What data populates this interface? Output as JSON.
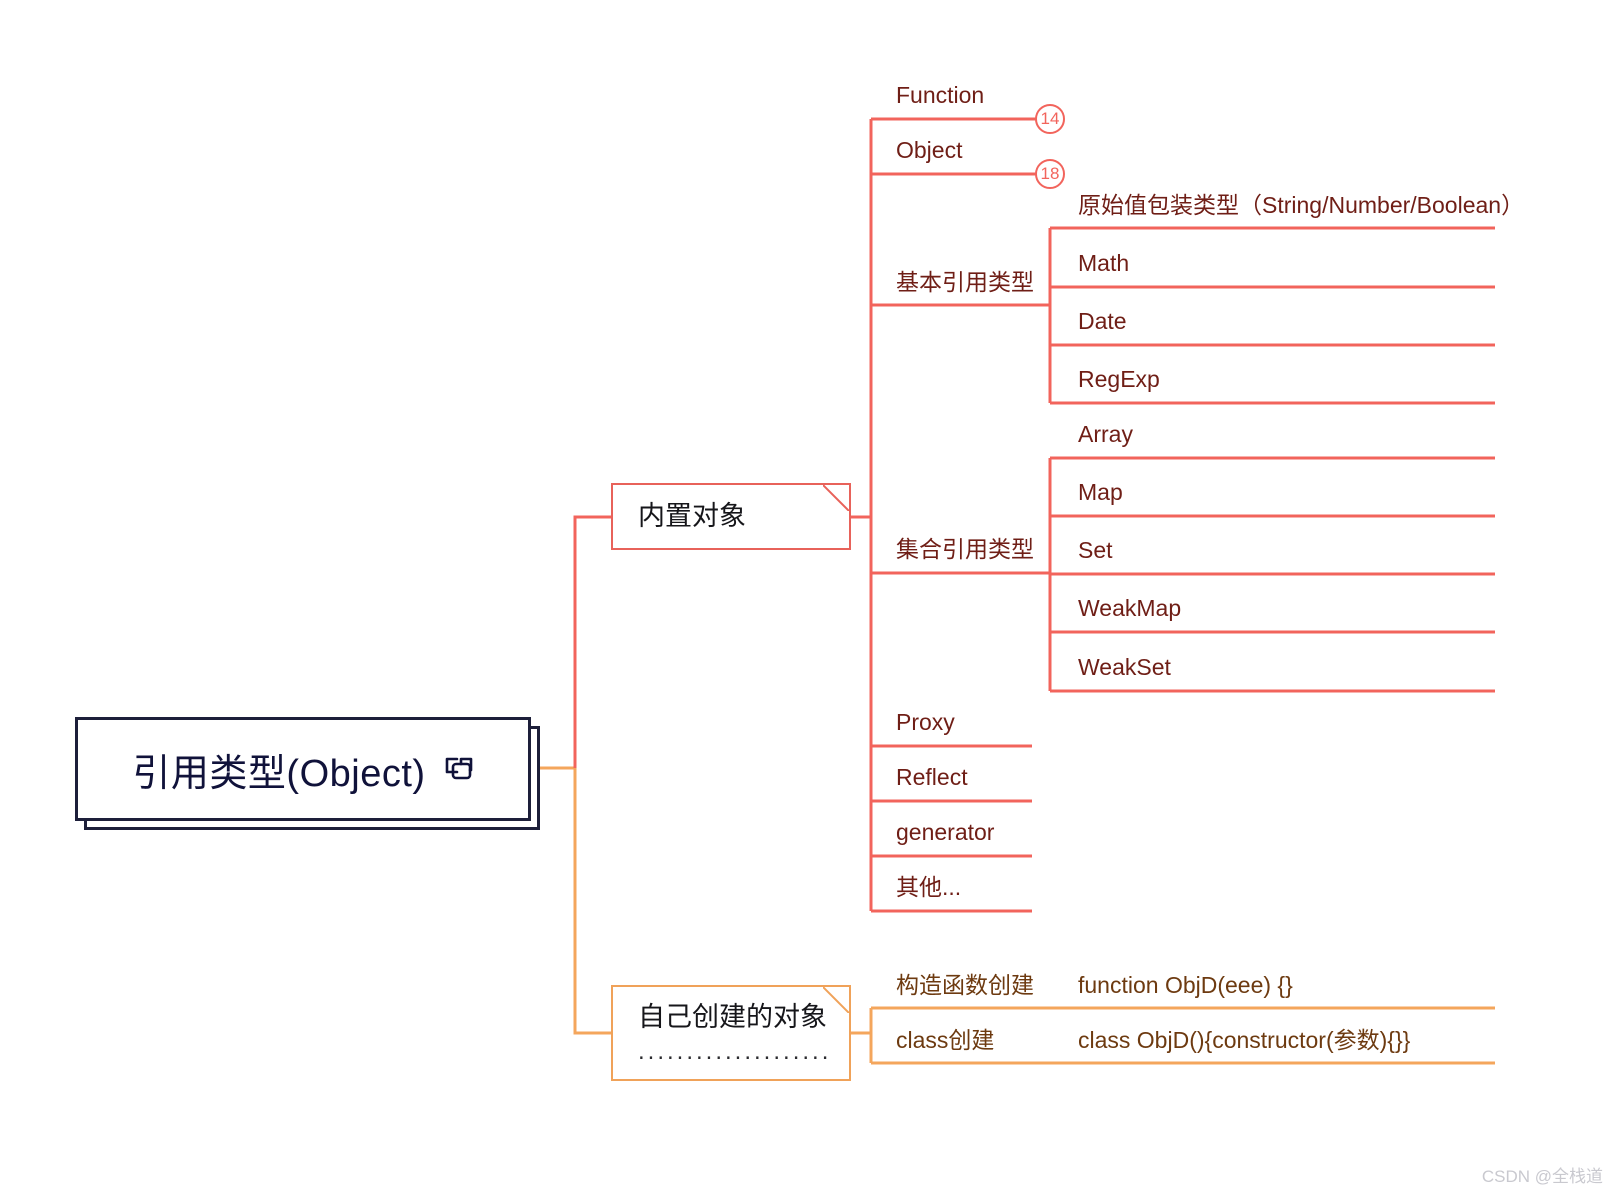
{
  "colors": {
    "root_border": "#1d1f3a",
    "root_text": "#10123a",
    "branch_red": "#f2645c",
    "branch_orange": "#f4a65c",
    "leaf_red_text": "#6f1e16",
    "leaf_orange_text": "#6d3a10",
    "background": "#ffffff",
    "watermark": "#c9c9cf"
  },
  "root": {
    "label": "引用类型(Object)",
    "icon": "copy-icon"
  },
  "branches": [
    {
      "id": "builtin",
      "label": "内置对象",
      "color": "#f2645c",
      "children": [
        {
          "label": "Function",
          "badge": "14"
        },
        {
          "label": "Object",
          "badge": "18"
        },
        {
          "label": "基本引用类型",
          "children": [
            {
              "label": "原始值包装类型（String/Number/Boolean）"
            },
            {
              "label": "Math"
            },
            {
              "label": "Date"
            },
            {
              "label": "RegExp"
            }
          ]
        },
        {
          "label": "集合引用类型",
          "children": [
            {
              "label": "Array"
            },
            {
              "label": "Map"
            },
            {
              "label": "Set"
            },
            {
              "label": "WeakMap"
            },
            {
              "label": "WeakSet"
            }
          ]
        },
        {
          "label": "Proxy"
        },
        {
          "label": "Reflect"
        },
        {
          "label": "generator"
        },
        {
          "label": "其他..."
        }
      ]
    },
    {
      "id": "custom",
      "label": "自己创建的对象",
      "sublabel": "....................",
      "color": "#f4a65c",
      "children": [
        {
          "label": "构造函数创建",
          "detail": "function ObjD(eee) {}"
        },
        {
          "label": "class创建",
          "detail": "class ObjD(){constructor(参数){}}"
        }
      ]
    }
  ],
  "watermark": "CSDN @全栈道"
}
